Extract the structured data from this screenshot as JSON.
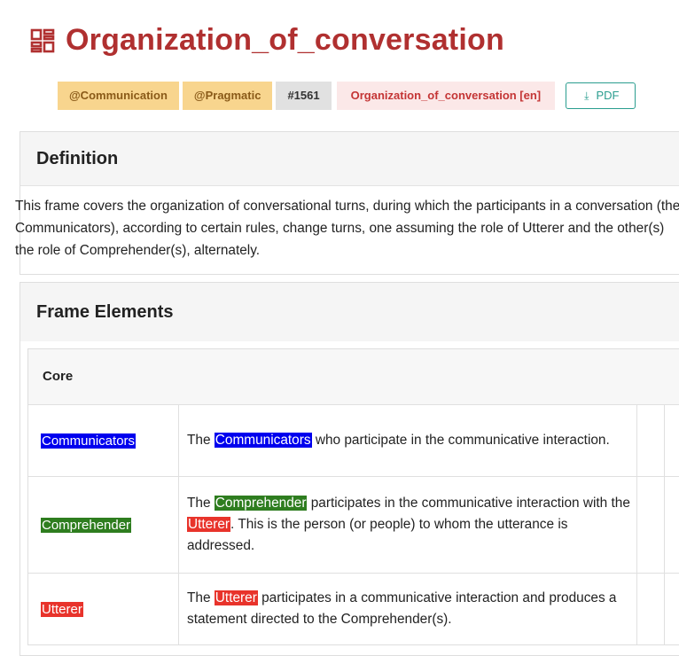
{
  "title": "Organization_of_conversation",
  "colors": {
    "title": "#b03030",
    "communicators": "#0000ee",
    "comprehender": "#2e7d1f",
    "utterer": "#e8332b",
    "pdf_accent": "#2a9d8f"
  },
  "icons": {
    "frame": "frame-grid-icon",
    "pdf": "download-icon"
  },
  "badges": {
    "domain1": "@Communication",
    "domain2": "@Pragmatic",
    "id": "#1561",
    "lang": "Organization_of_conversation [en]",
    "pdf_label": "PDF"
  },
  "definition": {
    "heading": "Definition",
    "text": "This frame covers the organization of conversational turns, during which the participants in a conversation (the Communicators), according to certain rules, change turns, one assuming the role of Utterer and the other(s) the role of Comprehender(s), alternately."
  },
  "frame_elements": {
    "heading": "Frame Elements",
    "core_label": "Core",
    "rows": [
      {
        "name": "Communicators",
        "def_pre": "The ",
        "def_hl": "Communicators",
        "def_post": " who participate in the communicative interaction."
      },
      {
        "name": "Comprehender",
        "def_pre": "The ",
        "def_hl": "Comprehender",
        "def_mid": " participates in the communicative interaction with the ",
        "def_hl2": "Utterer",
        "def_post": ". This is the person (or people) to whom the utterance is addressed."
      },
      {
        "name": "Utterer",
        "def_pre": "The ",
        "def_hl": "Utterer",
        "def_post": " participates in a communicative interaction and produces a statement directed to the Comprehender(s)."
      }
    ]
  }
}
